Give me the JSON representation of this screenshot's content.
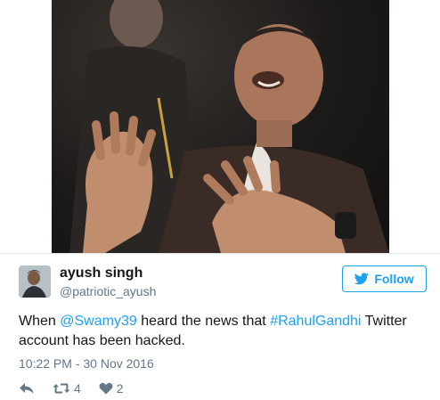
{
  "tweet": {
    "photo": {
      "description_icon": "photo-image"
    },
    "user": {
      "name": "ayush singh",
      "handle": "@patriotic_ayush"
    },
    "follow_label": "Follow",
    "text": {
      "part1": "When ",
      "mention": "@Swamy39",
      "part2": " heard the news that ",
      "hashtag": "#RahulGandhi",
      "part3": " Twitter account has been hacked."
    },
    "timestamp": "10:22 PM - 30 Nov 2016",
    "actions": {
      "reply_icon": "reply-icon",
      "retweet_icon": "retweet-icon",
      "retweet_count": "4",
      "like_icon": "heart-icon",
      "like_count": "2"
    }
  },
  "colors": {
    "accent": "#1da1f2",
    "text": "#14171a",
    "muted": "#657786",
    "divider": "#e1e8ed"
  }
}
